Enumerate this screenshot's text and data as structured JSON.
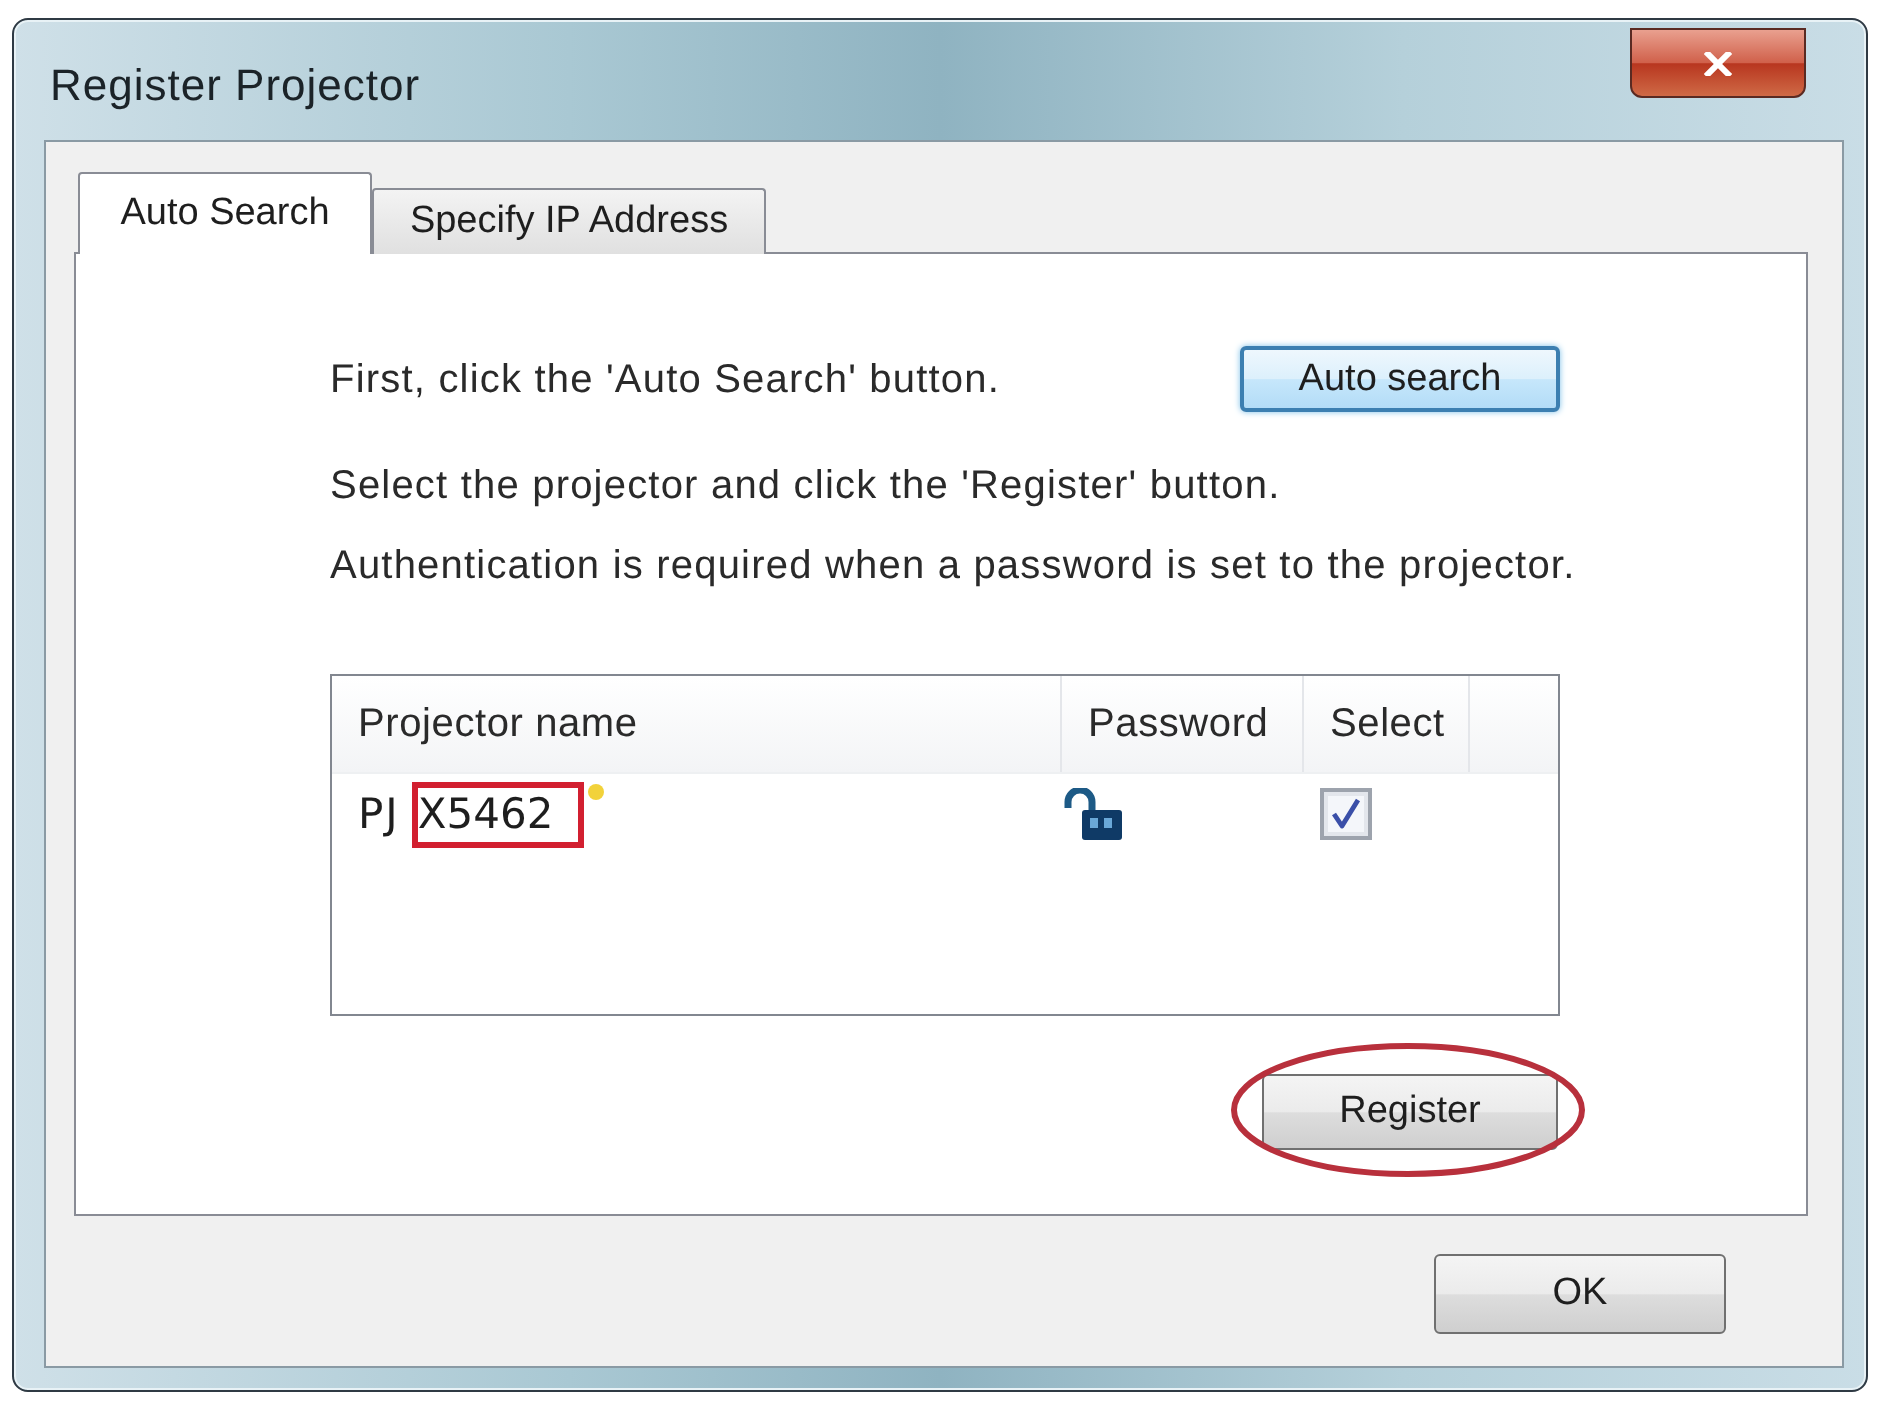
{
  "window": {
    "title": "Register Projector"
  },
  "tabs": [
    {
      "label": "Auto Search",
      "selected": true
    },
    {
      "label": "Specify IP Address",
      "selected": false
    }
  ],
  "instructions": [
    "First, click the 'Auto Search' button.",
    "Select the projector and click the 'Register' button.",
    "Authentication is required when a password is set to the projector."
  ],
  "auto_search_button": {
    "label": "Auto search",
    "focused": true
  },
  "projector_list": {
    "columns": [
      "Projector name",
      "Password",
      "Select"
    ],
    "rows": [
      {
        "name": "PJ",
        "model": "X5462",
        "model_marked": true,
        "marker": true,
        "locked": false,
        "selected": true
      }
    ]
  },
  "register_button": {
    "label": "Register",
    "circled": true
  },
  "buttons": [
    "OK"
  ]
}
